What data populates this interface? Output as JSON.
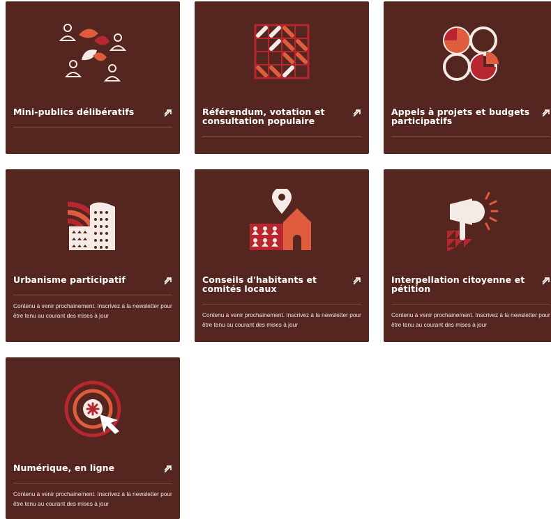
{
  "colors": {
    "card_bg": "#54261f",
    "accent_orange": "#e05c3e",
    "accent_red": "#b8272f",
    "cream": "#f5ebe6"
  },
  "cards": [
    {
      "title": "Mini-publics délibératifs",
      "illustration": "people-and-leaves-icon",
      "arrow_icon": "arrow-up-right-icon"
    },
    {
      "title": "Référendum, votation et consultation populaire",
      "illustration": "ballot-grid-icon",
      "arrow_icon": "arrow-up-right-icon"
    },
    {
      "title": "Appels à projets et budgets participatifs",
      "illustration": "pie-circles-icon",
      "arrow_icon": "arrow-up-right-icon"
    },
    {
      "title": "Urbanisme participatif",
      "illustration": "buildings-icon",
      "arrow_icon": "arrow-up-right-icon",
      "description": "Contenu à venir prochainement. Inscrivez à la newsletter pour être tenu au courant des mises à jour"
    },
    {
      "title": "Conseils d'habitants et comités locaux",
      "illustration": "map-pin-house-icon",
      "arrow_icon": "arrow-up-right-icon",
      "description": "Contenu à venir prochainement. Inscrivez à la newsletter pour être tenu au courant des mises à jour"
    },
    {
      "title": "Interpellation citoyenne et pétition",
      "illustration": "megaphone-icon",
      "arrow_icon": "arrow-up-right-icon",
      "description": "Contenu à venir prochainement. Inscrivez à la newsletter pour être tenu au courant des mises à jour"
    },
    {
      "title": "Numérique, en ligne",
      "illustration": "target-cursor-icon",
      "arrow_icon": "arrow-up-right-icon",
      "description": "Contenu à venir prochainement. Inscrivez à la newsletter pour être tenu au courant des mises à jour"
    }
  ]
}
